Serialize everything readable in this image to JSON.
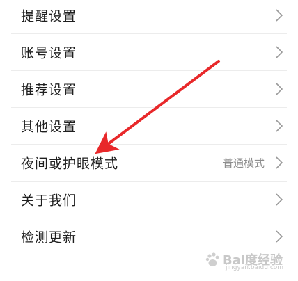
{
  "settings_list": [
    {
      "label": "提醒设置",
      "value": ""
    },
    {
      "label": "账号设置",
      "value": ""
    },
    {
      "label": "推荐设置",
      "value": ""
    },
    {
      "label": "其他设置",
      "value": ""
    },
    {
      "label": "夜间或护眼模式",
      "value": "普通模式"
    },
    {
      "label": "关于我们",
      "value": ""
    },
    {
      "label": "检测更新",
      "value": ""
    }
  ],
  "watermark": {
    "text": "Bai度经验",
    "sub": "jingyan.baidu.com"
  },
  "colors": {
    "annotation_arrow": "#e8282a",
    "divider": "#ececec",
    "chevron": "#9a9a9a"
  },
  "icons": {
    "chevron": "chevron-right-icon",
    "arrow": "red-arrow-annotation"
  }
}
